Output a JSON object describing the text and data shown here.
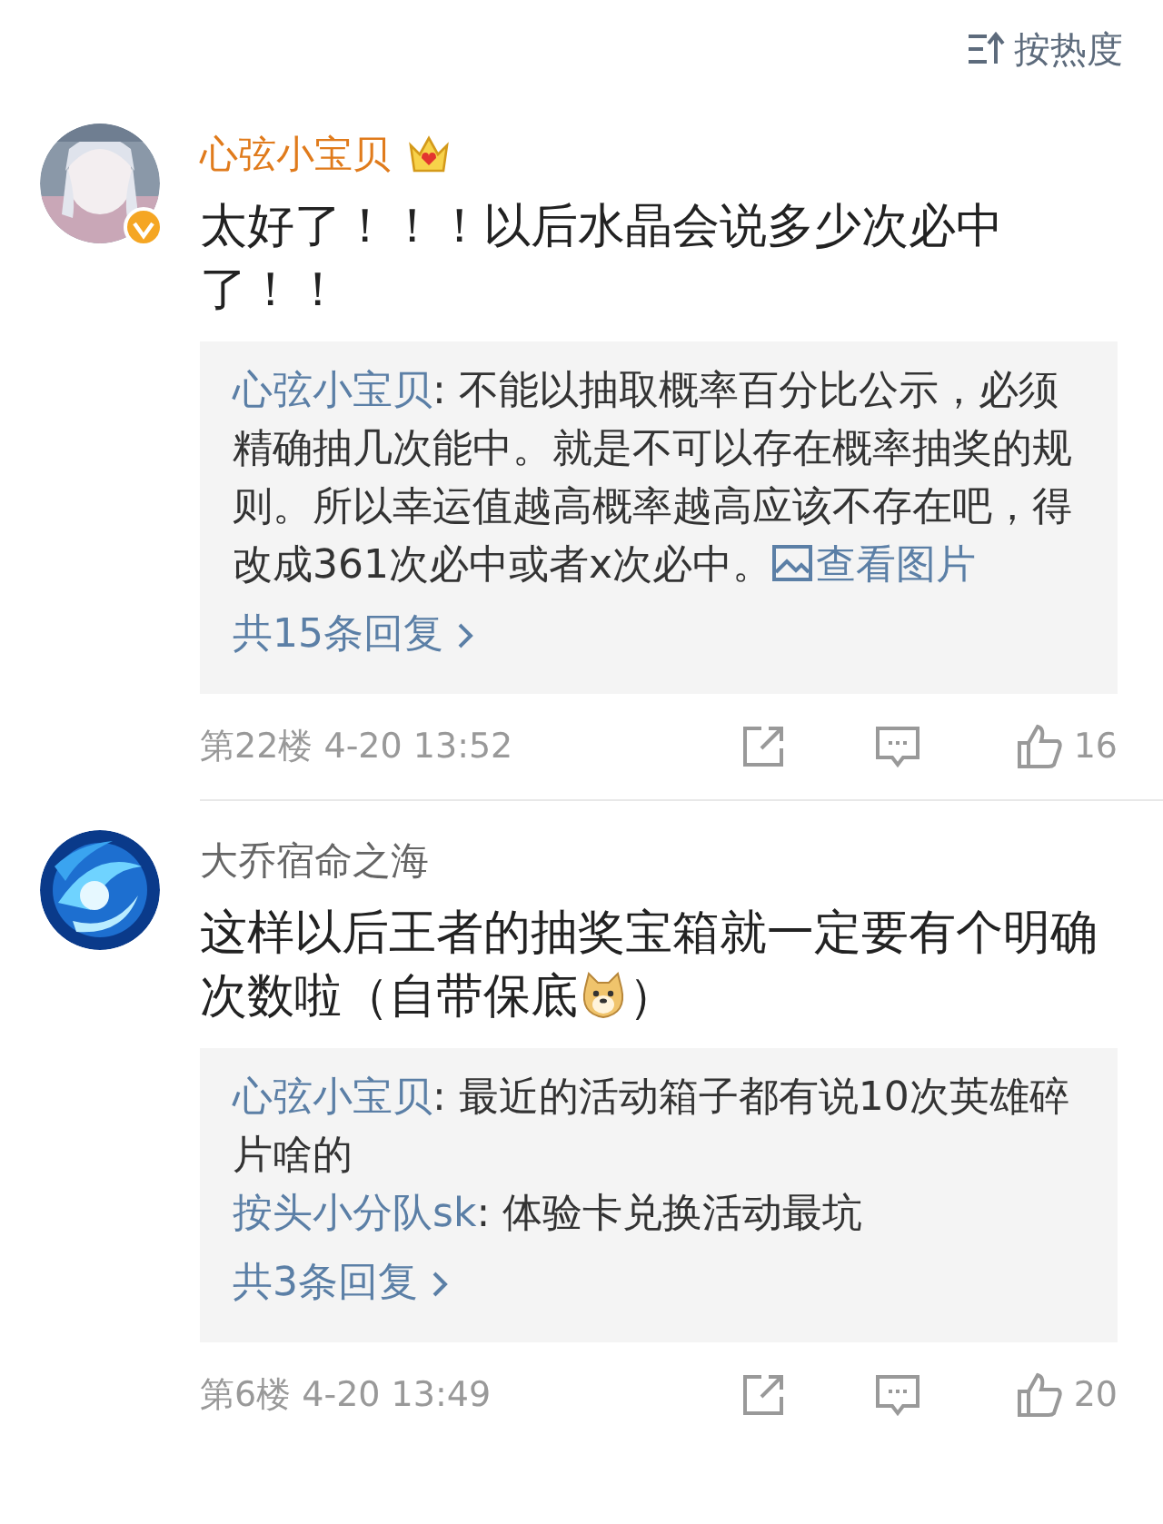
{
  "sort_button": {
    "label": "按热度"
  },
  "comments": [
    {
      "username": "心弦小宝贝",
      "vip": true,
      "verified": true,
      "segments": [
        {
          "kind": "text",
          "text": "太好了！！！以后水晶会说多少次必中了！！"
        }
      ],
      "replies": [
        {
          "author": "心弦小宝贝",
          "text": ": 不能以抽取概率百分比公示，必须精确抽几次能中。就是不可以存在概率抽奖的规则。所以幸运值越高概率越高应该不存在吧，得改成361次必中或者x次必中。",
          "link": "查看图片"
        }
      ],
      "more_replies": "共15条回复",
      "floor": "第22楼",
      "time": "4-20 13:52",
      "likes": "16"
    },
    {
      "username": "大乔宿命之海",
      "vip": false,
      "verified": false,
      "segments": [
        {
          "kind": "text",
          "text": "这样以后王者的抽奖宝箱就一定要有个明确次数啦（自带保底"
        },
        {
          "kind": "emoji"
        },
        {
          "kind": "text",
          "text": "）"
        }
      ],
      "replies": [
        {
          "author": "心弦小宝贝",
          "text": ": 最近的活动箱子都有说10次英雄碎片啥的"
        },
        {
          "author": "按头小分队sk",
          "text": ": 体验卡兑换活动最坑"
        }
      ],
      "more_replies": "共3条回复",
      "floor": "第6楼",
      "time": "4-20 13:49",
      "likes": "20"
    }
  ]
}
